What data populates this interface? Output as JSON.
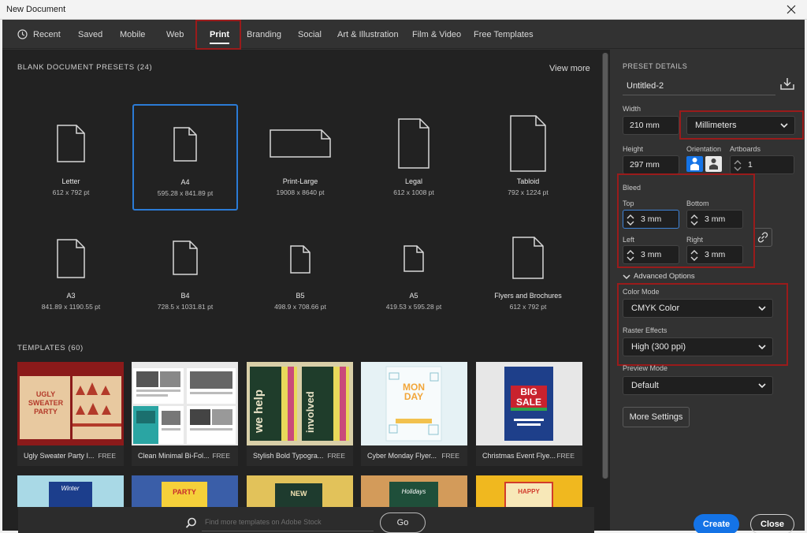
{
  "window": {
    "title": "New Document"
  },
  "tabs": [
    {
      "label": "Recent"
    },
    {
      "label": "Saved"
    },
    {
      "label": "Mobile"
    },
    {
      "label": "Web"
    },
    {
      "label": "Print"
    },
    {
      "label": "Branding"
    },
    {
      "label": "Social"
    },
    {
      "label": "Art & Illustration"
    },
    {
      "label": "Film & Video"
    },
    {
      "label": "Free Templates"
    }
  ],
  "blank_presets": {
    "heading": "BLANK DOCUMENT PRESETS",
    "count": "(24)",
    "view_more": "View more",
    "items": [
      {
        "name": "Letter",
        "size": "612 x 792 pt"
      },
      {
        "name": "A4",
        "size": "595.28 x 841.89 pt"
      },
      {
        "name": "Print-Large",
        "size": "19008 x 8640 pt"
      },
      {
        "name": "Legal",
        "size": "612 x 1008 pt"
      },
      {
        "name": "Tabloid",
        "size": "792 x 1224 pt"
      },
      {
        "name": "A3",
        "size": "841.89 x 1190.55 pt"
      },
      {
        "name": "B4",
        "size": "728.5 x 1031.81 pt"
      },
      {
        "name": "B5",
        "size": "498.9 x 708.66 pt"
      },
      {
        "name": "A5",
        "size": "419.53 x 595.28 pt"
      },
      {
        "name": "Flyers and Brochures",
        "size": "612 x 792 pt"
      }
    ]
  },
  "templates": {
    "heading": "TEMPLATES",
    "count": "(60)",
    "items": [
      {
        "name": "Ugly Sweater Party I...",
        "badge": "FREE",
        "thumb_text": [
          "UGLY",
          "SWEATER",
          "PARTY"
        ]
      },
      {
        "name": "Clean Minimal Bi-Fol...",
        "badge": "FREE"
      },
      {
        "name": "Stylish Bold Typogra...",
        "badge": "FREE",
        "thumb_text": [
          "we help",
          "involved"
        ]
      },
      {
        "name": "Cyber Monday Flyer...",
        "badge": "FREE",
        "thumb_text": [
          "MON",
          "DAY"
        ]
      },
      {
        "name": "Christmas Event Flye...",
        "badge": "FREE",
        "thumb_text": [
          "BIG",
          "SALE"
        ]
      }
    ],
    "row2_text": [
      "Winter",
      "PARTY",
      "NEW",
      "Holidays",
      "HAPPY"
    ]
  },
  "search": {
    "placeholder": "Find more templates on Adobe Stock",
    "go_label": "Go"
  },
  "details": {
    "heading": "PRESET DETAILS",
    "doc_name": "Untitled-2",
    "width_label": "Width",
    "width": "210 mm",
    "units": "Millimeters",
    "height_label": "Height",
    "height": "297 mm",
    "orientation_label": "Orientation",
    "artboards_label": "Artboards",
    "artboards": "1",
    "bleed_label": "Bleed",
    "top_label": "Top",
    "top": "3 mm",
    "bottom_label": "Bottom",
    "bottom": "3 mm",
    "left_label": "Left",
    "left": "3 mm",
    "right_label": "Right",
    "right": "3 mm",
    "advanced_label": "Advanced Options",
    "color_mode_label": "Color Mode",
    "color_mode": "CMYK Color",
    "raster_label": "Raster Effects",
    "raster": "High (300 ppi)",
    "preview_label": "Preview Mode",
    "preview": "Default",
    "more_settings": "More Settings",
    "create": "Create",
    "close": "Close"
  },
  "colors": {
    "accent": "#1473e6",
    "highlight": "#9a1b1b",
    "selected": "#2b7bd6"
  }
}
